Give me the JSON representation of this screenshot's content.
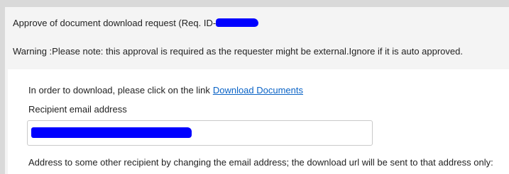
{
  "request": {
    "title": "Approve of document download request (Req. ID-",
    "warning": "Warning :Please note: this approval is required as the requester might be external.Ignore if it is auto approved."
  },
  "card": {
    "download_text": "In order to download, please click on the link",
    "download_link": "Download Documents",
    "recipient_label": "Recipient email address",
    "email_value": "",
    "address_note": "Address to some other recipient by changing the email address; the download url will be sent to that address only:"
  },
  "colors": {
    "redaction": "#0000ff",
    "link": "#0a63c6",
    "background": "#f4f4f4",
    "card": "#ffffff"
  }
}
